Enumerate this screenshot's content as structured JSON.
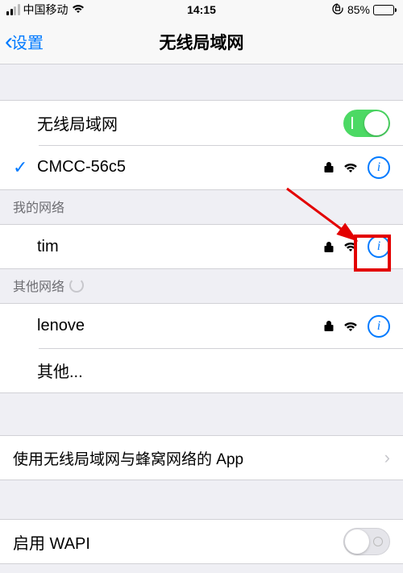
{
  "status": {
    "carrier": "中国移动",
    "time": "14:15",
    "battery_pct": "85%",
    "battery_fill": 85
  },
  "nav": {
    "back_label": "设置",
    "title": "无线局域网"
  },
  "wifi_toggle": {
    "label": "无线局域网",
    "on": true
  },
  "connected": {
    "name": "CMCC-56c5",
    "locked": true
  },
  "sections": {
    "my_networks": "我的网络",
    "other_networks": "其他网络"
  },
  "my_networks": [
    {
      "name": "tim",
      "locked": true
    }
  ],
  "other_networks": [
    {
      "name": "lenove",
      "locked": true
    }
  ],
  "other_label": "其他...",
  "apps_row": "使用无线局域网与蜂窝网络的 App",
  "wapi_row": "启用 WAPI"
}
